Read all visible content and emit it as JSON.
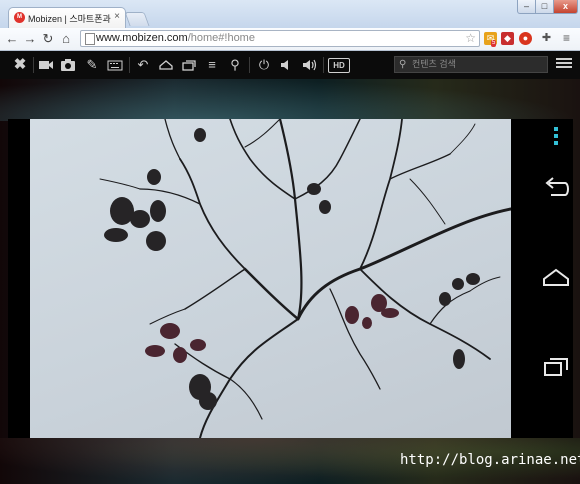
{
  "browser": {
    "tab_title": "Mobizen | 스마트폰과 컴",
    "tab_close": "×",
    "window_buttons": {
      "minimize": "–",
      "maximize": "□",
      "close": "x"
    },
    "url_host": "www.mobizen.com",
    "url_path": "/home#!home",
    "favicon_text": "M",
    "ext_badge": "5"
  },
  "mobizen_toolbar": {
    "hd_label": "HD",
    "search_placeholder": "컨텐츠 검색"
  },
  "device": {
    "menu_accent_color": "#33c0d6"
  },
  "watermark": "http://blog.arinae.net"
}
